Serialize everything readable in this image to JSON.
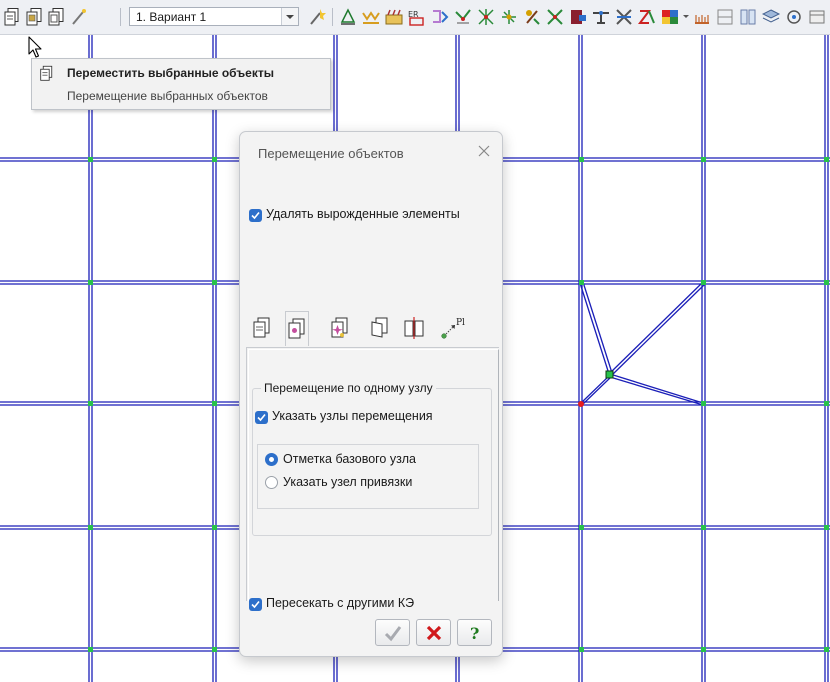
{
  "toolbar": {
    "variant_value": "1. Вариант 1",
    "icons": [
      "move-selected-objects-icon",
      "copy-objects-icon",
      "mirror-copy-icon",
      "edit-wand-icon",
      "apply-icon",
      "supports-icon",
      "loads-icon",
      "fragment-icon",
      "rigid-links-icon",
      "schema-icon",
      "nodes-grid-icon",
      "triangulation-icon",
      "rotate-icon",
      "split-icon",
      "stiffness-icon",
      "hinges-icon",
      "beams-icon",
      "reinforcement-icon",
      "color-scale-icon",
      "diagram-icon"
    ]
  },
  "tooltip": {
    "title": "Переместить выбранные объекты",
    "description": "Перемещение выбранных объектов"
  },
  "dialog": {
    "title": "Перемещение объектов",
    "delete_degenerate": {
      "label": "Удалять вырожденные элементы",
      "checked": true
    },
    "tabs": [
      "move-by-node-tab",
      "move-by-vector-tab",
      "move-by-displacement-tab",
      "rotate-tab",
      "mirror-tab",
      "pl-tab"
    ],
    "tab_pl_label": "Pl",
    "group_title": "Перемещение по одному узлу",
    "specify_nodes": {
      "label": "Указать узлы перемещения",
      "checked": true
    },
    "radio_base_node": {
      "label": "Отметка базового узла",
      "selected": true
    },
    "radio_anchor_node": {
      "label": "Указать узел привязки",
      "selected": false
    },
    "intersect_fe": {
      "label": "Пересекать с другими КЭ",
      "checked": true
    },
    "buttons": [
      "apply-button",
      "cancel-button",
      "help-button"
    ]
  },
  "colors": {
    "grid_line": "#1b1fb8",
    "node": "#27c24a",
    "selected_node": "#e81c1c",
    "accent": "#2d6fca"
  }
}
